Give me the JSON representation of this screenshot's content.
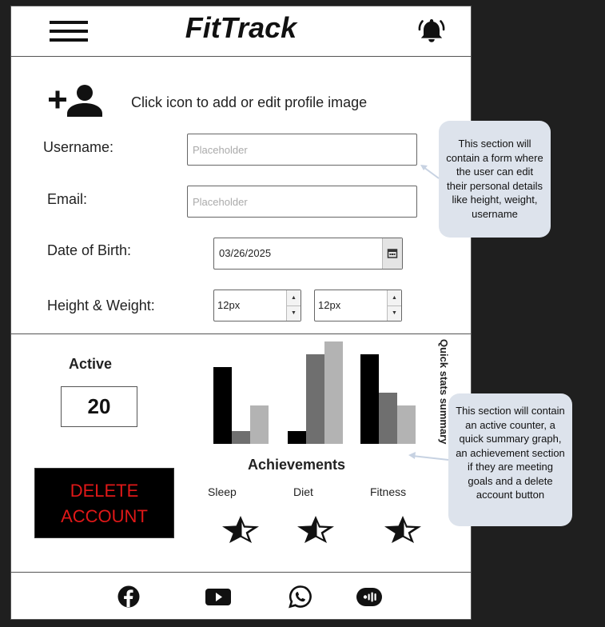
{
  "header": {
    "title": "FitTrack",
    "menu_icon": "hamburger-menu-icon",
    "notification_icon": "bell-icon"
  },
  "profile": {
    "add_image_icon": "add-user-icon",
    "add_image_hint": "Click icon to add or edit profile image",
    "username": {
      "label": "Username:",
      "placeholder": "Placeholder",
      "value": ""
    },
    "email": {
      "label": "Email:",
      "placeholder": "Placeholder",
      "value": ""
    },
    "dob": {
      "label": "Date of Birth:",
      "value": "03/26/2025"
    },
    "height_weight": {
      "label": "Height & Weight:",
      "height_value": "12px",
      "weight_value": "12px"
    }
  },
  "stats": {
    "active_label": "Active",
    "active_count": "20",
    "delete_line1": "DELETE",
    "delete_line2": "ACCOUNT",
    "chart_title": "Quick stats summary",
    "achievements_title": "Achievements",
    "achievements": [
      {
        "label": "Sleep",
        "icon": "star-half-icon"
      },
      {
        "label": "Diet",
        "icon": "star-half-icon"
      },
      {
        "label": "Fitness",
        "icon": "star-half-icon"
      }
    ]
  },
  "chart_data": {
    "type": "bar",
    "title": "Quick stats summary",
    "categories": [
      "",
      "",
      ""
    ],
    "series": [
      {
        "values": [
          6,
          1,
          7
        ],
        "color": "#000000"
      },
      {
        "values": [
          1,
          7,
          4
        ],
        "color": "#6f6f6f"
      },
      {
        "values": [
          3,
          8,
          3
        ],
        "color": "#b3b3b3"
      }
    ],
    "ylim": [
      0,
      8
    ],
    "grid": false
  },
  "footer": {
    "icons": [
      "facebook-icon",
      "youtube-icon",
      "whatsapp-icon",
      "podcast-icon"
    ]
  },
  "annotations": {
    "form_note": "This section will contain a form where the user can edit their personal details like height, weight, username",
    "stats_note": "This section will contain an active counter, a quick summary graph,  an achievement section if they are meeting goals and a delete account button"
  },
  "colors": {
    "background": "#1f1f1f",
    "delete_text": "#e01818",
    "callout": "#dde3ec"
  }
}
